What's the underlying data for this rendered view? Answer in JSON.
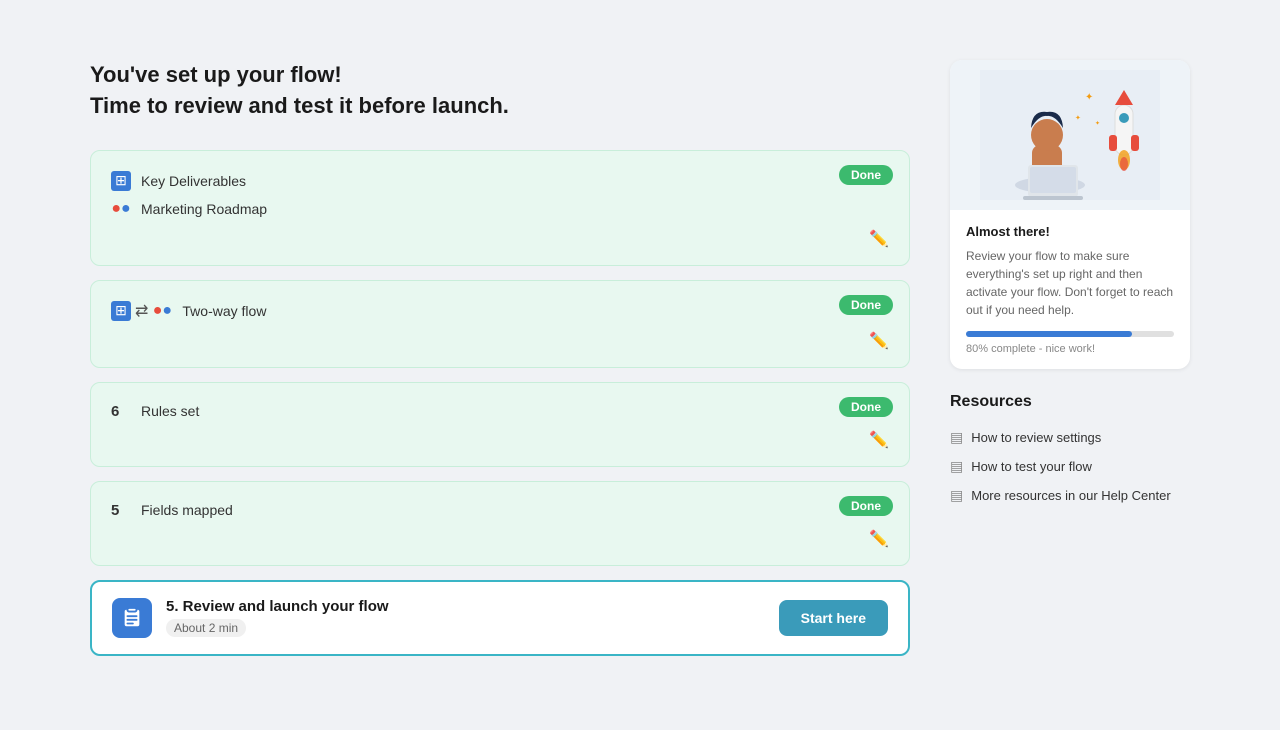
{
  "page": {
    "title_line1": "You've set up your flow!",
    "title_line2": "Time to review and test it before launch."
  },
  "cards": [
    {
      "id": "card-1",
      "type": "double-row",
      "badge": "Done",
      "row1_label": "Key Deliverables",
      "row2_label": "Marketing Roadmap",
      "has_edit": true
    },
    {
      "id": "card-2",
      "type": "two-way",
      "badge": "Done",
      "label": "Two-way flow",
      "has_edit": true
    },
    {
      "id": "card-3",
      "type": "number",
      "badge": "Done",
      "number": "6",
      "label": "Rules set",
      "has_edit": true
    },
    {
      "id": "card-4",
      "type": "number",
      "badge": "Done",
      "number": "5",
      "label": "Fields mapped",
      "has_edit": true
    }
  ],
  "launch_card": {
    "title": "5. Review and launch your flow",
    "time": "About 2 min",
    "button_label": "Start here"
  },
  "sidebar": {
    "almost_title": "Almost there!",
    "description": "Review your flow to make sure everything's set up right and then activate your flow. Don't forget to reach out if you need help.",
    "progress_percent": 80,
    "progress_label": "80% complete - nice work!"
  },
  "resources": {
    "title": "Resources",
    "items": [
      {
        "label": "How to review settings"
      },
      {
        "label": "How to test your flow"
      },
      {
        "label": "More resources in our Help Center"
      }
    ]
  }
}
